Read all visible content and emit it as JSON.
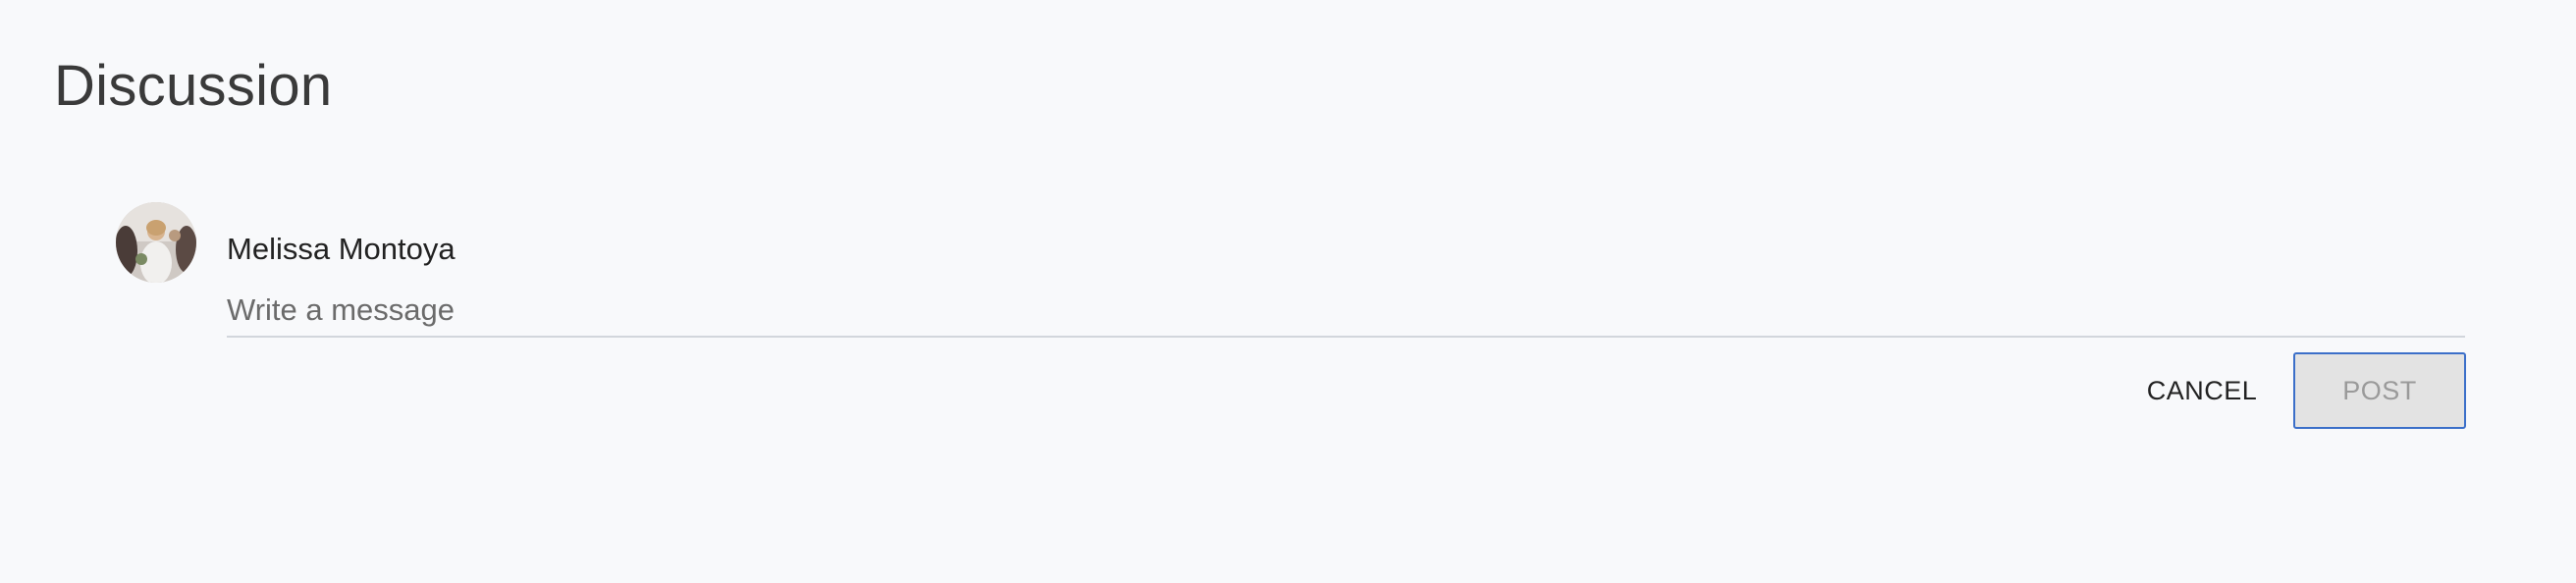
{
  "discussion": {
    "title": "Discussion"
  },
  "composer": {
    "author_name": "Melissa Montoya",
    "message_value": "",
    "message_placeholder": "Write a message",
    "cancel_label": "CANCEL",
    "post_label": "POST",
    "post_enabled": false
  },
  "colors": {
    "background": "#f8f9fb",
    "focus_outline": "#3b6fc9",
    "disabled_button_bg": "#e3e3e3"
  }
}
